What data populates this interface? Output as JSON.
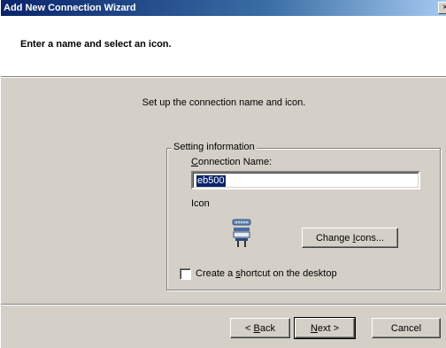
{
  "window": {
    "title": "Add New Connection Wizard",
    "close_glyph": "×"
  },
  "header": {
    "title": "Enter a name and select an icon."
  },
  "main": {
    "subtitle": "Set up the connection name and icon.",
    "group_label": "Setting information",
    "connection_name_label_prefix": "",
    "connection_name_label_accel": "C",
    "connection_name_label_rest": "onnection Name:",
    "connection_name_value": "eb500",
    "icon_label": "Icon",
    "icon_name": "serial-port-icon",
    "change_icons_prefix": "Change ",
    "change_icons_accel": "I",
    "change_icons_rest": "cons...",
    "shortcut_prefix": "Create a ",
    "shortcut_accel": "s",
    "shortcut_rest": "hortcut on the desktop",
    "shortcut_checked": false
  },
  "footer": {
    "back_prefix": "< ",
    "back_accel": "B",
    "back_rest": "ack",
    "next_accel": "N",
    "next_rest": "ext >",
    "cancel_label": "Cancel"
  }
}
